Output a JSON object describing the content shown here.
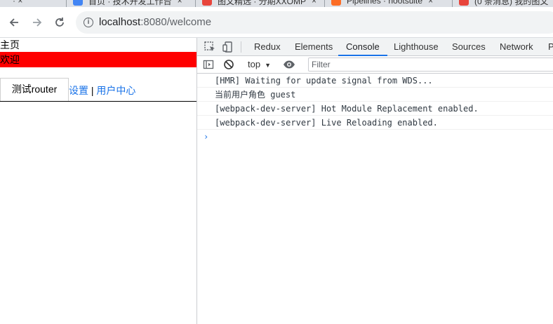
{
  "browser": {
    "tabs": [
      {
        "title": "首页 · 技术开发工作台",
        "favicon_color": "#4285f4"
      },
      {
        "title": "图文精选 · 分期XXOMP",
        "favicon_color": "#e8453c"
      },
      {
        "title": "Pipelines · hootsuite",
        "favicon_color": "#fc6d26"
      },
      {
        "title": "(0 条消息) 我的图文",
        "favicon_color": "#e8453c"
      }
    ],
    "url_host": "localhost",
    "url_rest": ":8080/welcome"
  },
  "page": {
    "home_label": "主页",
    "welcome_label": "欢迎",
    "router_button": "测试router",
    "settings_link": "设置",
    "separator": "|",
    "user_center_link": "用户中心"
  },
  "devtools": {
    "tabs": [
      "Redux",
      "Elements",
      "Console",
      "Lighthouse",
      "Sources",
      "Network",
      "P"
    ],
    "active_tab": "Console",
    "context": "top",
    "filter_placeholder": "Filter",
    "messages": [
      "[HMR] Waiting for update signal from WDS...",
      "当前用户角色 guest",
      "[webpack-dev-server] Hot Module Replacement enabled.",
      "[webpack-dev-server] Live Reloading enabled."
    ],
    "prompt_symbol": "›"
  }
}
